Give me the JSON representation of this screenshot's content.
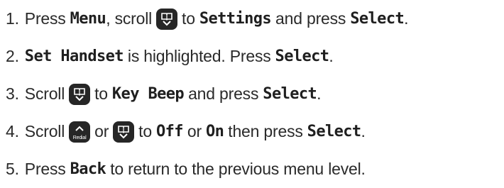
{
  "steps": [
    {
      "number": "1.",
      "t1": "Press",
      "lcd1": "Menu",
      "t2": ", scroll",
      "t3": "to",
      "lcd2": "Settings",
      "t4": "and press",
      "lcd3": "Select",
      "t5": "."
    },
    {
      "number": "2.",
      "lcd1": "Set Handset",
      "t1": "is highlighted. Press",
      "lcd2": "Select",
      "t2": "."
    },
    {
      "number": "3.",
      "t1": "Scroll",
      "t2": "to",
      "lcd1": "Key Beep",
      "t3": "and press",
      "lcd2": "Select",
      "t4": "."
    },
    {
      "number": "4.",
      "t1": "Scroll",
      "t2": "or",
      "t3": "to",
      "lcd1": "Off",
      "t4": "or",
      "lcd2": "On",
      "t5": "then press",
      "lcd3": "Select",
      "t6": "."
    },
    {
      "number": "5.",
      "t1": "Press",
      "lcd1": "Back",
      "t2": "to return to the previous menu level."
    }
  ],
  "icons": {
    "scroll_key": "phonebook-scroll-down-icon",
    "redial_key": "redial-scroll-up-icon",
    "redial_label": "Redial"
  },
  "colors": {
    "text": "#2a2a2a",
    "key_background": "#262626",
    "key_foreground": "#ffffff"
  }
}
